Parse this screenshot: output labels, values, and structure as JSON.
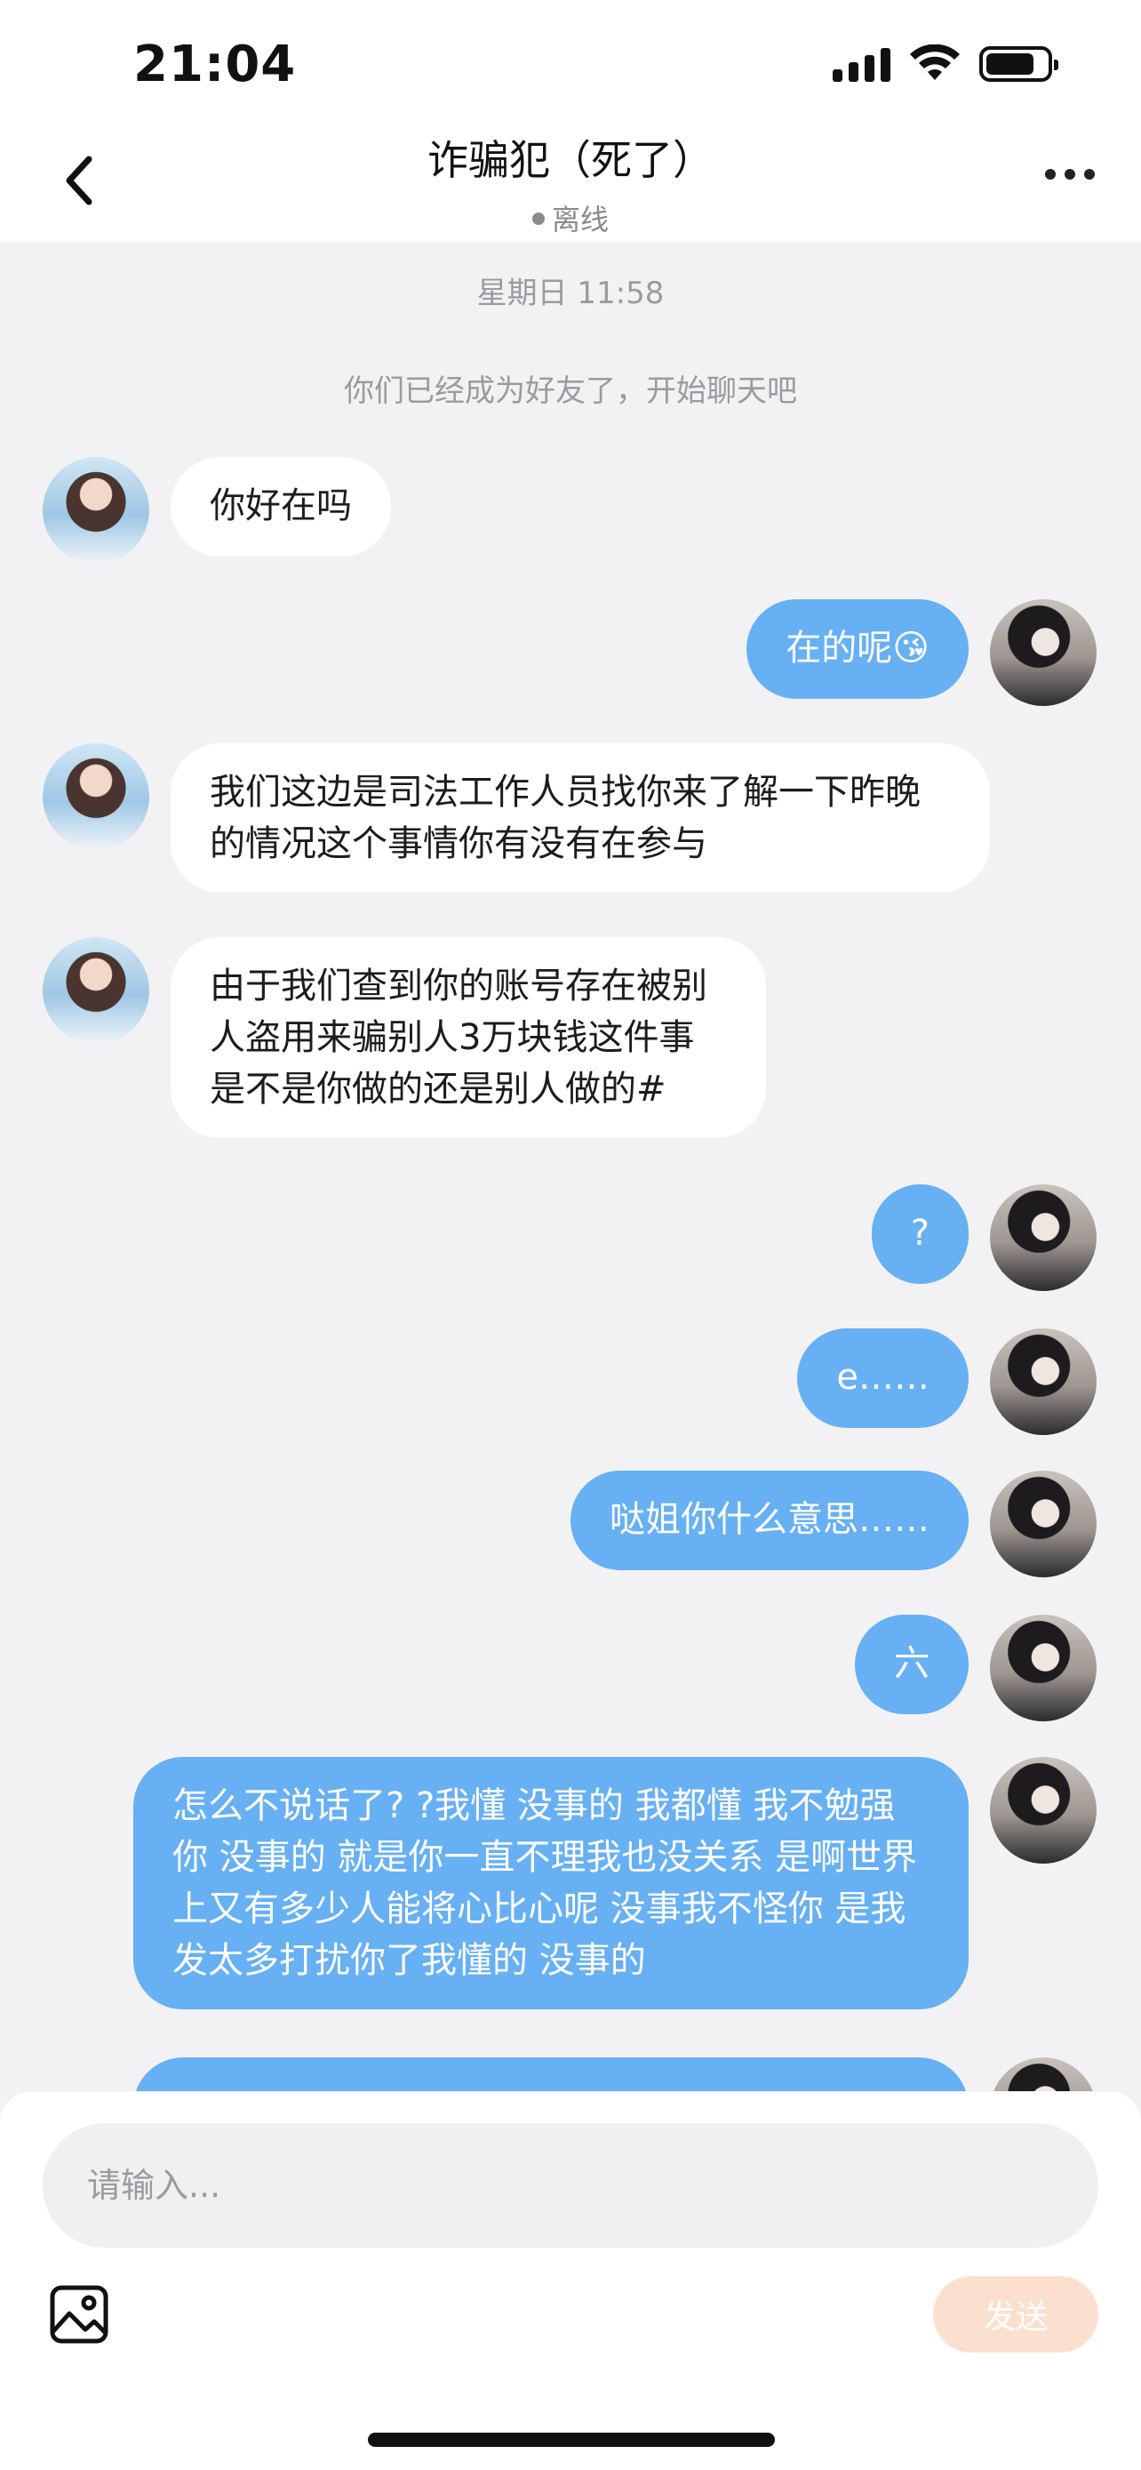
{
  "status_bar": {
    "time": "21:04"
  },
  "header": {
    "title": "诈骗犯（死了）",
    "status": "离线"
  },
  "chat": {
    "time_divider": "星期日 11:58",
    "system_note": "你们已经成为好友了，开始聊天吧",
    "messages": [
      {
        "from": "them",
        "text": "你好在吗"
      },
      {
        "from": "me",
        "text": "在的呢😘"
      },
      {
        "from": "them",
        "text": "我们这边是司法工作人员找你来了解一下昨晚的情况这个事情你有没有在参与"
      },
      {
        "from": "them",
        "text": "由于我们查到你的账号存在被别人盗用来骗别人3万块钱这件事是不是你做的还是别人做的#"
      },
      {
        "from": "me",
        "text": "?"
      },
      {
        "from": "me",
        "text": "e……"
      },
      {
        "from": "me",
        "text": "哒姐你什么意思……"
      },
      {
        "from": "me",
        "text": "六"
      },
      {
        "from": "me",
        "text": "怎么不说话了? ?我懂 没事的 我都懂 我不勉强你 没事的 就是你一直不理我也没关系 是啊世界上又有多少人能将心比心呢 没事我不怪你 是我发太多打扰你了我懂的 没事的"
      },
      {
        "from": "me",
        "text": ""
      }
    ]
  },
  "input": {
    "placeholder": "请输入...",
    "send_label": "发送"
  },
  "colors": {
    "my_bubble": "#67b0f3",
    "their_bubble": "#ffffff",
    "send_button": "#fbe0cf",
    "background": "#f2f2f4"
  }
}
